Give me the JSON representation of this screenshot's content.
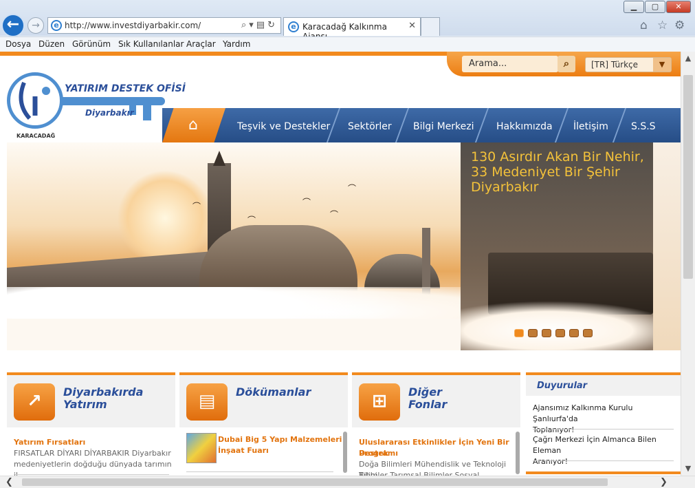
{
  "browser": {
    "url": "http://www.investdiyarbakir.com/",
    "tab_title": "Karacadağ Kalkınma Ajansı...",
    "menu": [
      "Dosya",
      "Düzen",
      "Görünüm",
      "Sık Kullanılanlar",
      "Araçlar",
      "Yardım"
    ]
  },
  "header": {
    "search_placeholder": "Arama...",
    "language": "[TR] Türkçe",
    "logo_line1": "YATIRIM DESTEK OFİSİ",
    "logo_line2": "Diyarbakır",
    "logo_line3": "KARACADAĞ"
  },
  "nav": {
    "items": [
      "Teşvik ve Destekler",
      "Sektörler",
      "Bilgi Merkezi",
      "Hakkımızda",
      "İletişim",
      "S.S.S"
    ]
  },
  "slider": {
    "caption_line1": "130 Asırdır Akan Bir Nehir,",
    "caption_line2": "33 Medeniyet Bir Şehir",
    "caption_line3": "Diyarbakır",
    "dot_count": 6,
    "active_dot": 1
  },
  "boxes": [
    {
      "title_line1": "Diyarbakırda",
      "title_line2": "Yatırım",
      "item_title": "Yatırım Fırsatları",
      "item_text1": "FIRSATLAR DİYARI DİYARBAKIR Diyarbakır",
      "item_text2": "medeniyetlerin doğduğu dünyada tarımın il..."
    },
    {
      "title_line1": "Dökümanlar",
      "item_title1": "Dubai Big 5 Yapı Malzemeleri",
      "item_title2": "İnşaat Fuarı"
    },
    {
      "title_line1": "Diğer",
      "title_line2": "Fonlar",
      "item_title1": "Uluslararası Etkinlikler İçin Yeni Bir Destek",
      "item_title2": "Programı",
      "item_text1": "Doğa Bilimleri Mühendislik ve Teknoloji Tıbbi",
      "item_text2": "Bilimler Tarımsal Bilimler Sosyal..."
    }
  ],
  "duyurular": {
    "title": "Duyurular",
    "items": [
      {
        "line1": "Ajansımız Kalkınma Kurulu Şanlıurfa'da",
        "line2": "Toplanıyor!"
      },
      {
        "line1": "Çağrı Merkezi İçin Almanca Bilen Eleman",
        "line2": "Aranıyor!"
      }
    ]
  },
  "colors": {
    "accent": "#f28a1e",
    "nav_blue": "#2b4f9a",
    "caption_gold": "#f4c23a"
  }
}
